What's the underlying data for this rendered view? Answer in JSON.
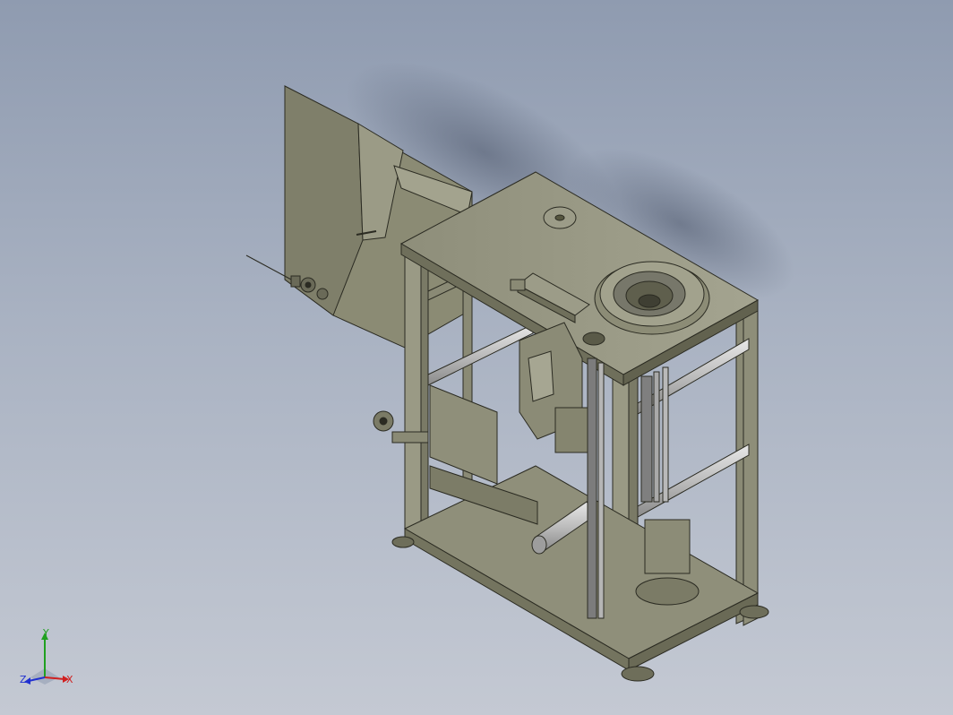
{
  "viewport": {
    "background_top": "#8f9bb0",
    "background_bottom": "#c4c9d3",
    "model_color": "#8a8a75"
  },
  "triad": {
    "x_label": "X",
    "y_label": "Y",
    "z_label": "Z",
    "x_color": "#d02020",
    "y_color": "#20a020",
    "z_color": "#2030d0"
  }
}
